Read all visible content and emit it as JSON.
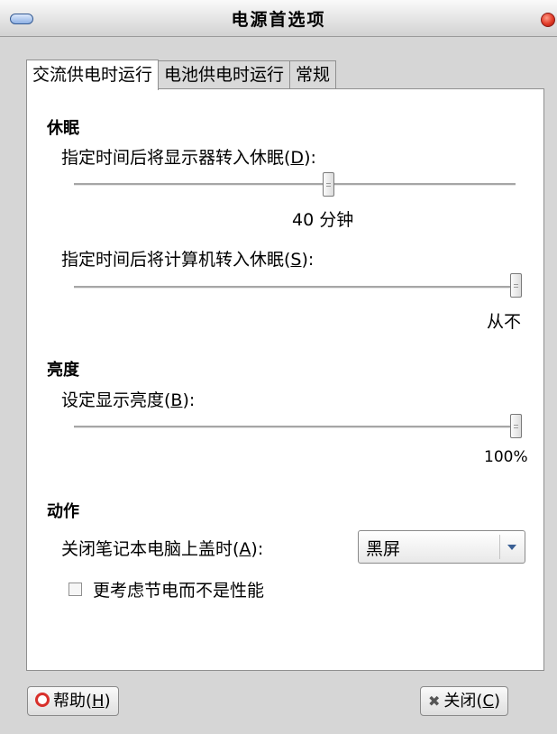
{
  "window": {
    "title": "电源首选项"
  },
  "tabs": [
    "交流供电时运行",
    "电池供电时运行",
    "常规"
  ],
  "sleep": {
    "heading": "休眠",
    "display_label_pre": "指定时间后将显示器转入休眠(",
    "display_label_key": "D",
    "display_label_post": "):",
    "display_value_text": "40 分钟",
    "display_value_minutes": 40,
    "computer_label_pre": "指定时间后将计算机转入休眠(",
    "computer_label_key": "S",
    "computer_label_post": "):",
    "computer_value_text": "从不"
  },
  "brightness": {
    "heading": "亮度",
    "label_pre": "设定显示亮度(",
    "label_key": "B",
    "label_post": "):",
    "value_text": "100%",
    "value_percent": 100
  },
  "actions": {
    "heading": "动作",
    "lid_label_pre": "关闭笔记本电脑上盖时(",
    "lid_label_key": "A",
    "lid_label_post": "):",
    "lid_selected": "黑屏",
    "save_power_label": "更考虑节电而不是性能",
    "save_power_checked": false
  },
  "buttons": {
    "help_pre": "帮助(",
    "help_key": "H",
    "help_post": ")",
    "close_pre": "关闭(",
    "close_key": "C",
    "close_post": ")"
  },
  "icons": {
    "help": "help-lifebuoy-icon",
    "close": "close-x-icon",
    "dropdown": "chevron-down-icon"
  },
  "colors": {
    "accent": "#3a5f94",
    "close_red": "#e03a27"
  }
}
